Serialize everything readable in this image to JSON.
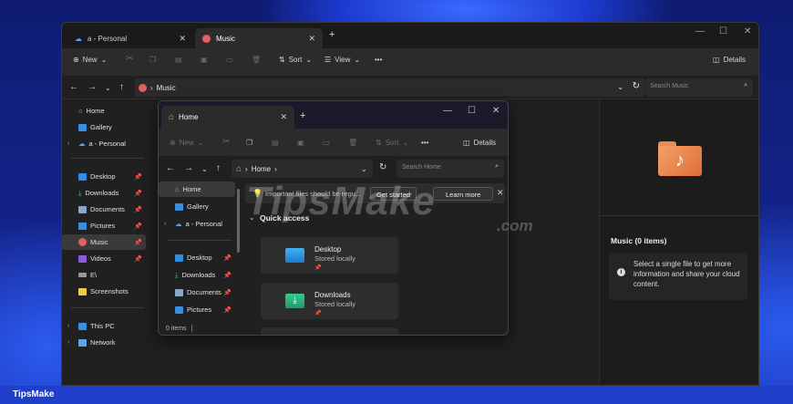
{
  "window": {
    "tabs": [
      {
        "label": "a - Personal"
      },
      {
        "label": "Music"
      }
    ],
    "new_tab": "+",
    "controls": {
      "minimize": "—",
      "maximize": "☐",
      "close": "✕"
    }
  },
  "toolbar": {
    "new_label": "New",
    "sort_label": "Sort",
    "view_label": "View",
    "more_label": "•••",
    "details_label": "Details"
  },
  "address": {
    "path_segment": "Music",
    "search_placeholder": "Search Music"
  },
  "sidebar": {
    "items": [
      {
        "label": "Home"
      },
      {
        "label": "Gallery"
      },
      {
        "label": "a - Personal"
      },
      {
        "label": "Desktop"
      },
      {
        "label": "Downloads"
      },
      {
        "label": "Documents"
      },
      {
        "label": "Pictures"
      },
      {
        "label": "Music"
      },
      {
        "label": "Videos"
      },
      {
        "label": "E\\"
      },
      {
        "label": "Screenshots"
      },
      {
        "label": "This PC"
      },
      {
        "label": "Network"
      }
    ]
  },
  "details": {
    "title": "Music (0 items)",
    "info": "Select a single file to get more information and share your cloud content."
  },
  "window2": {
    "tab_label": "Home",
    "new_tab": "+",
    "controls": {
      "minimize": "—",
      "maximize": "☐",
      "close": "✕"
    },
    "toolbar": {
      "new_label": "New",
      "sort_label": "Sort",
      "more_label": "•••",
      "details_label": "Details"
    },
    "address": {
      "path_segment": "Home",
      "search_placeholder": "Search Home"
    },
    "sidebar": {
      "items": [
        {
          "label": "Home"
        },
        {
          "label": "Gallery"
        },
        {
          "label": "a - Personal"
        },
        {
          "label": "Desktop"
        },
        {
          "label": "Downloads"
        },
        {
          "label": "Documents"
        },
        {
          "label": "Pictures"
        }
      ]
    },
    "banner": {
      "text": "Important files should be regu...",
      "get_started": "Get started",
      "learn_more": "Learn more"
    },
    "quick_access_label": "Quick access",
    "cards": [
      {
        "name": "Desktop",
        "status": "Stored locally"
      },
      {
        "name": "Downloads",
        "status": "Stored locally"
      }
    ],
    "status": "0 items"
  },
  "watermark": {
    "main": "TipsMake",
    "suffix": ".com"
  },
  "footer": {
    "label": "TipsMake"
  },
  "colors": {
    "accent": "#1f3ec9",
    "folder_orange": "#e8804a",
    "window_bg": "#202020"
  }
}
